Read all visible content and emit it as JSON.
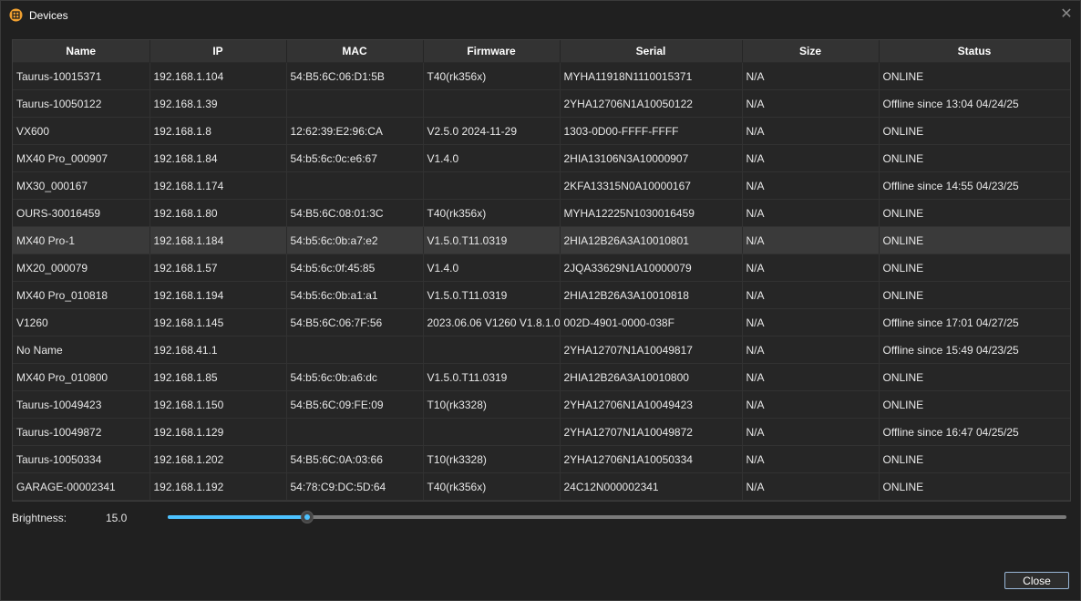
{
  "window": {
    "title": "Devices",
    "close_glyph": "✕"
  },
  "table": {
    "columns": [
      "Name",
      "IP",
      "MAC",
      "Firmware",
      "Serial",
      "Size",
      "Status"
    ],
    "selected_row": 6,
    "rows": [
      [
        "Taurus-10015371",
        "192.168.1.104",
        "54:B5:6C:06:D1:5B",
        "T40(rk356x)",
        "MYHA11918N1110015371",
        "N/A",
        "ONLINE"
      ],
      [
        "Taurus-10050122",
        "192.168.1.39",
        "",
        "",
        "2YHA12706N1A10050122",
        "N/A",
        "Offline since 13:04 04/24/25"
      ],
      [
        "VX600",
        "192.168.1.8",
        "12:62:39:E2:96:CA",
        "V2.5.0 2024-11-29",
        "1303-0D00-FFFF-FFFF",
        "N/A",
        "ONLINE"
      ],
      [
        "MX40 Pro_000907",
        "192.168.1.84",
        "54:b5:6c:0c:e6:67",
        "V1.4.0",
        "2HIA13106N3A10000907",
        "N/A",
        "ONLINE"
      ],
      [
        "MX30_000167",
        "192.168.1.174",
        "",
        "",
        "2KFA13315N0A10000167",
        "N/A",
        "Offline since 14:55 04/23/25"
      ],
      [
        "OURS-30016459",
        "192.168.1.80",
        "54:B5:6C:08:01:3C",
        "T40(rk356x)",
        "MYHA12225N1030016459",
        "N/A",
        "ONLINE"
      ],
      [
        "MX40 Pro-1",
        "192.168.1.184",
        "54:b5:6c:0b:a7:e2",
        "V1.5.0.T11.0319",
        "2HIA12B26A3A10010801",
        "N/A",
        "ONLINE"
      ],
      [
        "MX20_000079",
        "192.168.1.57",
        "54:b5:6c:0f:45:85",
        "V1.4.0",
        "2JQA33629N1A10000079",
        "N/A",
        "ONLINE"
      ],
      [
        "MX40 Pro_010818",
        "192.168.1.194",
        "54:b5:6c:0b:a1:a1",
        "V1.5.0.T11.0319",
        "2HIA12B26A3A10010818",
        "N/A",
        "ONLINE"
      ],
      [
        "V1260",
        "192.168.1.145",
        "54:B5:6C:06:7F:56",
        "2023.06.06 V1260 V1.8.1.0",
        "002D-4901-0000-038F",
        "N/A",
        "Offline since 17:01 04/27/25"
      ],
      [
        "No Name",
        "192.168.41.1",
        "",
        "",
        "2YHA12707N1A10049817",
        "N/A",
        "Offline since 15:49 04/23/25"
      ],
      [
        "MX40 Pro_010800",
        "192.168.1.85",
        "54:b5:6c:0b:a6:dc",
        "V1.5.0.T11.0319",
        "2HIA12B26A3A10010800",
        "N/A",
        "ONLINE"
      ],
      [
        "Taurus-10049423",
        "192.168.1.150",
        "54:B5:6C:09:FE:09",
        "T10(rk3328)",
        "2YHA12706N1A10049423",
        "N/A",
        "ONLINE"
      ],
      [
        "Taurus-10049872",
        "192.168.1.129",
        "",
        "",
        "2YHA12707N1A10049872",
        "N/A",
        "Offline since 16:47 04/25/25"
      ],
      [
        "Taurus-10050334",
        "192.168.1.202",
        "54:B5:6C:0A:03:66",
        "T10(rk3328)",
        "2YHA12706N1A10050334",
        "N/A",
        "ONLINE"
      ],
      [
        "GARAGE-00002341",
        "192.168.1.192",
        "54:78:C9:DC:5D:64",
        "T40(rk356x)",
        "24C12N000002341",
        "N/A",
        "ONLINE"
      ]
    ]
  },
  "brightness": {
    "label": "Brightness:",
    "value": "15.0",
    "level_fraction": 0.155
  },
  "footer": {
    "close_label": "Close"
  },
  "colors": {
    "accent": "#4cc2ff",
    "app_icon": "#f0a030"
  }
}
